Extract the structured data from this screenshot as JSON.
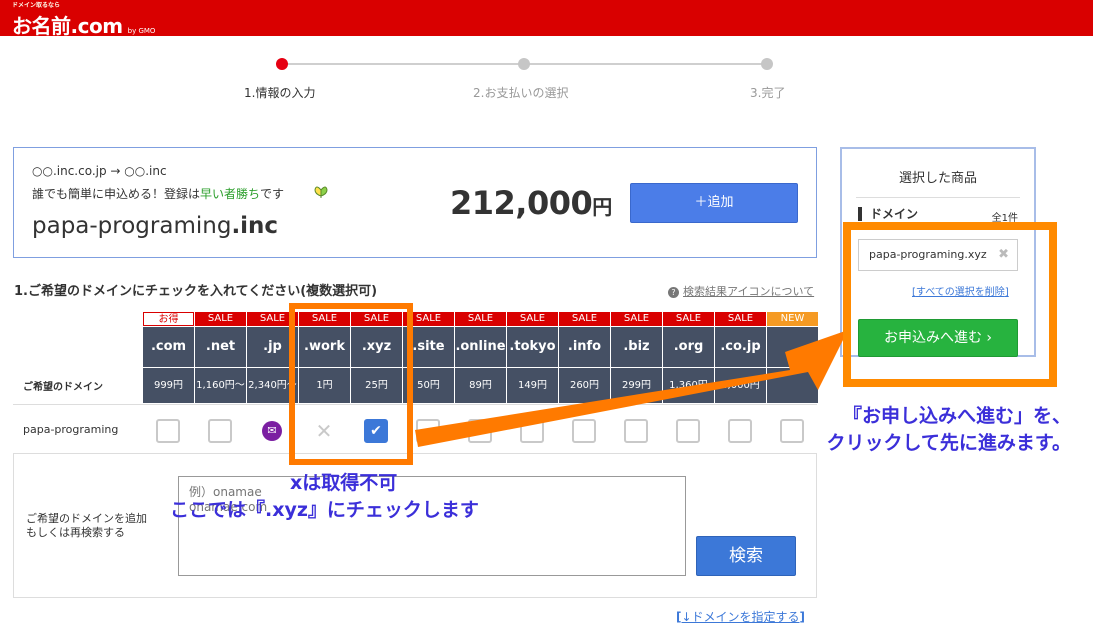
{
  "header": {
    "logo_tag": "ドメイン取るなら",
    "logo_main": "お名前.com",
    "logo_sub": "by GMO"
  },
  "steps": [
    {
      "label": "1.情報の入力",
      "active": true
    },
    {
      "label": "2.お支払いの選択",
      "active": false
    },
    {
      "label": "3.完了",
      "active": false
    }
  ],
  "promo": {
    "line1": "○○.inc.co.jp → ○○.inc",
    "line2_pre": "誰でも簡単に申込める！登録は",
    "line2_green": "早い者勝ち",
    "line2_post": "です",
    "domain_name": "papa-programing",
    "domain_tld": ".inc",
    "price": "212,000",
    "price_unit": "円",
    "add_button": "＋追加"
  },
  "domain_question": "1.ご希望のドメインにチェックを入れてください(複数選択可)",
  "help_link": "検索結果アイコンについて",
  "table": {
    "row_label": "ご希望のドメイン",
    "search_name": "papa-programing",
    "columns": [
      {
        "badge": "お得",
        "tld": ".com",
        "price": "999円",
        "state": "empty"
      },
      {
        "badge": "SALE",
        "tld": ".net",
        "price": "1,160円〜",
        "state": "empty"
      },
      {
        "badge": "SALE",
        "tld": ".jp",
        "price": "2,340円〜",
        "state": "mail"
      },
      {
        "badge": "SALE",
        "tld": ".work",
        "price": "1円",
        "state": "unavailable"
      },
      {
        "badge": "SALE",
        "tld": ".xyz",
        "price": "25円",
        "state": "checked"
      },
      {
        "badge": "SALE",
        "tld": ".site",
        "price": "50円",
        "state": "empty"
      },
      {
        "badge": "SALE",
        "tld": ".online",
        "price": "89円",
        "state": "empty"
      },
      {
        "badge": "SALE",
        "tld": ".tokyo",
        "price": "149円",
        "state": "empty"
      },
      {
        "badge": "SALE",
        "tld": ".info",
        "price": "260円",
        "state": "empty"
      },
      {
        "badge": "SALE",
        "tld": ".biz",
        "price": "299円",
        "state": "empty"
      },
      {
        "badge": "SALE",
        "tld": ".org",
        "price": "1,360円",
        "state": "empty"
      },
      {
        "badge": "SALE",
        "tld": ".co.jp",
        "price": "4,000円",
        "state": "empty"
      },
      {
        "badge": "NEW",
        "tld": "",
        "price": "",
        "state": "empty"
      }
    ],
    "search_label_1": "ご希望のドメインを追加",
    "search_label_2": "もしくは再検索する",
    "search_placeholder": "例）onamae\nonamae.com",
    "search_button": "検索"
  },
  "specify_link_open": "[",
  "specify_link": "↓ドメインを指定する",
  "specify_link_close": "]",
  "sidebar": {
    "title": "選択した商品",
    "domain_label": "ドメイン",
    "count": "全1件",
    "selected_domain": "papa-programing.xyz",
    "clear_all_open": "[",
    "clear_all": "すべての選択を削除",
    "clear_all_close": "]",
    "apply_button": "お申込みへ進む"
  },
  "annotations": {
    "note_right_1": "『お申し込みへ進む」を、",
    "note_right_2": "クリックして先に進みます。",
    "note_x": "xは取得不可",
    "note_xyz": "ここでは『.xyz』にチェックします"
  },
  "colors": {
    "brand_red": "#d90000",
    "highlight_orange": "#ff7a00",
    "annotation_blue": "#3b2fd9",
    "apply_green": "#27b33f",
    "button_blue": "#3c78d8"
  }
}
